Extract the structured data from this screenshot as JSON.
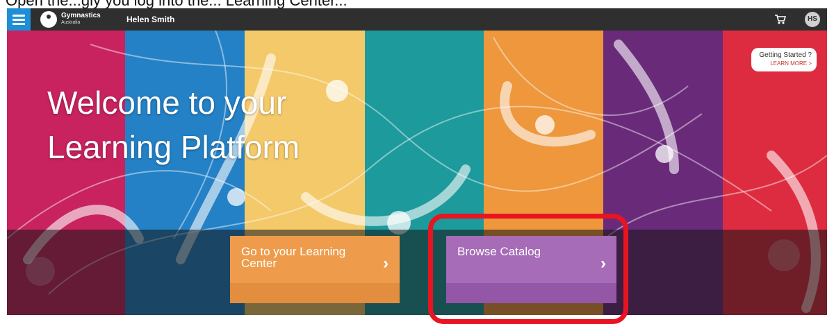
{
  "caption": "Open the...gly you log into the... Learning Center...",
  "topbar": {
    "brand_name": "Gymnastics",
    "brand_sub": "Australia",
    "user_name": "Helen Smith",
    "avatar_initials": "HS"
  },
  "hero": {
    "welcome_line1": "Welcome to your",
    "welcome_line2": "Learning Platform",
    "getting_started": "Getting Started ?",
    "learn_more": "LEARN MORE >"
  },
  "actions": {
    "learning_center_line1": "Go to your Learning",
    "learning_center_line2": "Center",
    "browse_catalog": "Browse Catalog",
    "chevron": "›"
  },
  "colors": {
    "stripe_colors": [
      "#c8235e",
      "#2481c6",
      "#f4c96a",
      "#1d9a9b",
      "#ee973d",
      "#6a2a7a",
      "#dd2c40"
    ],
    "menu_blue": "#1e8fd6",
    "highlight_red": "#e81421"
  },
  "icons": {
    "menu": "hamburger-icon",
    "logo": "gymnastics-logo-icon",
    "cart": "cart-icon"
  }
}
